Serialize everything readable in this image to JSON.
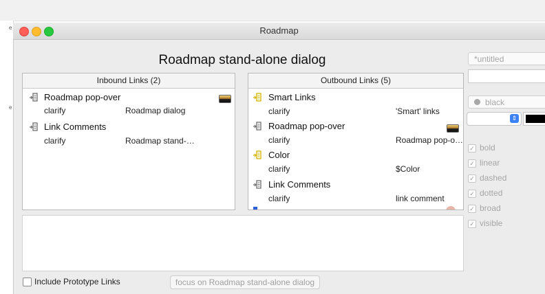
{
  "window": {
    "title": "Roadmap"
  },
  "dialog": {
    "title": "Roadmap stand-alone dialog"
  },
  "inbound": {
    "header": "Inbound Links (2)",
    "items": [
      {
        "title": "Roadmap pop-over",
        "type": "clarify",
        "target": "Roadmap dialog",
        "has_thumb": true
      },
      {
        "title": "Link Comments",
        "type": "clarify",
        "target": "Roadmap stand-…",
        "has_thumb": false
      }
    ]
  },
  "outbound": {
    "header": "Outbound Links (5)",
    "items": [
      {
        "title": "Smart Links",
        "type": "clarify",
        "target": "'Smart' links",
        "icon_color": "#d4b400"
      },
      {
        "title": "Roadmap pop-over",
        "type": "clarify",
        "target": "Roadmap pop-o…",
        "icon_color": "#6e6e6e"
      },
      {
        "title": "Color",
        "type": "clarify",
        "target": "$Color",
        "icon_color": "#d4b400"
      },
      {
        "title": "Link Comments",
        "type": "clarify",
        "target": "link comment",
        "icon_color": "#6e6e6e"
      }
    ]
  },
  "footer": {
    "include_label": "Include Prototype Links",
    "focus_label": "focus on Roadmap stand-alone dialog"
  },
  "sidebar": {
    "name_placeholder": "*untitled",
    "color_label": "black",
    "options": [
      "bold",
      "linear",
      "dashed",
      "dotted",
      "broad",
      "visible"
    ]
  },
  "colors": {
    "close": "#ff5f57",
    "minimize": "#febc2e",
    "zoom": "#28c840",
    "swatch": "#000000"
  }
}
